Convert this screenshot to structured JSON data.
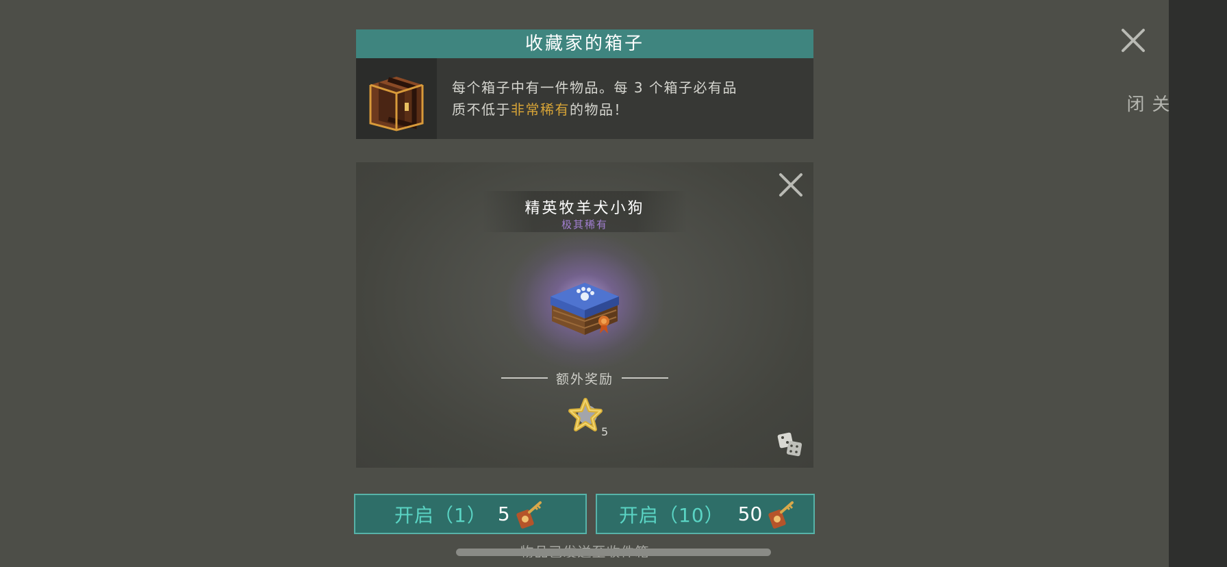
{
  "close_top": {
    "label": "关闭",
    "icon": "close-icon"
  },
  "header": {
    "title": "收藏家的箱子",
    "desc_line1": "每个箱子中有一件物品。每 3 个箱子必有品",
    "desc_line2_pre": "质不低于",
    "desc_line2_highlight": "非常稀有",
    "desc_line2_post": "的物品！",
    "highlight_color": "#d7a437",
    "icon": "treasure-chest-icon"
  },
  "reward": {
    "item_name": "精英牧羊犬小狗",
    "rarity": "极其稀有",
    "rarity_color": "#a27fd1",
    "item_icon": "dog-bed-box-icon",
    "bonus_label": "额外奖励",
    "bonus_icon": "golden-star-token-icon",
    "bonus_count": "5",
    "panel_close_icon": "close-icon",
    "dice_icon": "dice-icon"
  },
  "buttons": {
    "open_one_label": "开启（1）",
    "open_one_price": "5",
    "open_ten_label": "开启（10）",
    "open_ten_price": "50",
    "price_icon": "key-tag-icon",
    "accent_color": "#5ad4c4"
  },
  "footer": {
    "text": "物品已发送至收件箱"
  }
}
